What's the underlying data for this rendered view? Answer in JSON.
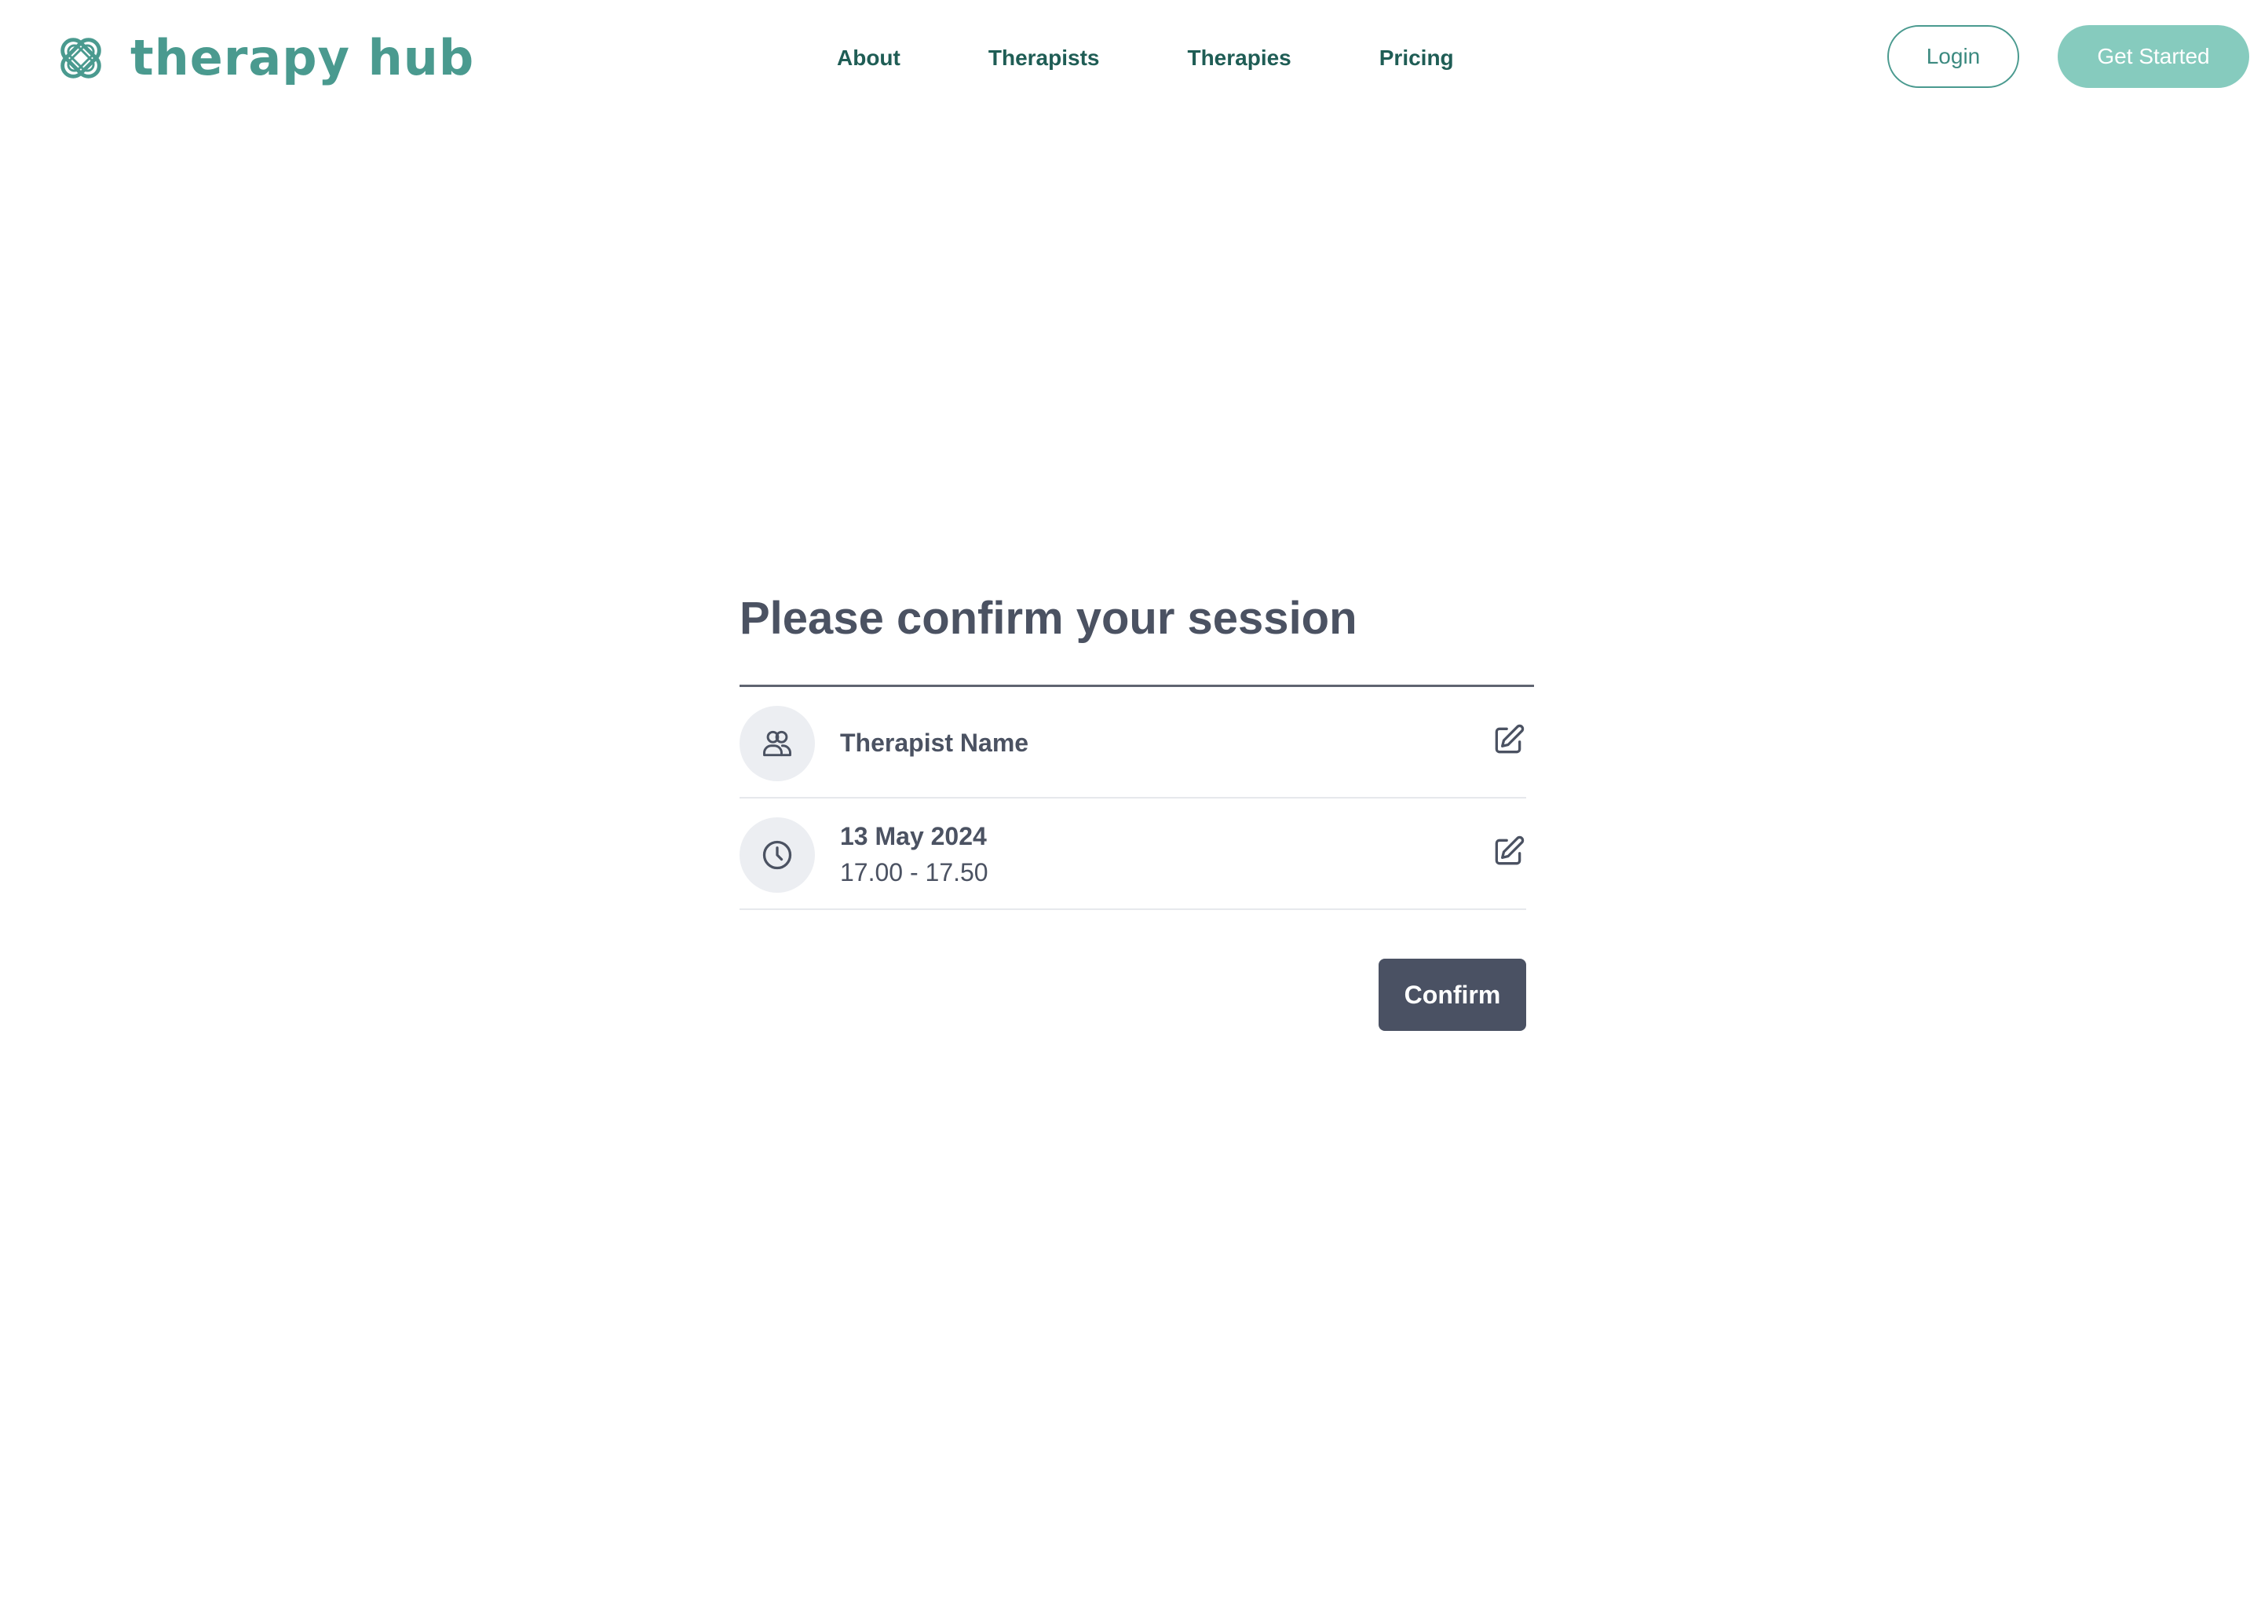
{
  "brand": {
    "name": "therapy hub",
    "logo_icon": "knot-logo-icon",
    "color": "#4a9a8f"
  },
  "nav": {
    "items": [
      {
        "label": "About"
      },
      {
        "label": "Therapists"
      },
      {
        "label": "Therapies"
      },
      {
        "label": "Pricing"
      }
    ]
  },
  "auth": {
    "login_label": "Login",
    "get_started_label": "Get Started"
  },
  "session": {
    "title": "Please confirm your session",
    "therapist": {
      "icon": "users-icon",
      "name": "Therapist Name",
      "edit_icon": "edit-icon"
    },
    "schedule": {
      "icon": "clock-icon",
      "date": "13 May 2024",
      "time": "17.00 - 17.50",
      "edit_icon": "edit-icon"
    },
    "confirm_label": "Confirm"
  },
  "colors": {
    "accent": "#4a9a8f",
    "accent_light": "#86cbbe",
    "nav_text": "#1f5d55",
    "primary_dark": "#4a5163",
    "text": "#4b5262"
  }
}
